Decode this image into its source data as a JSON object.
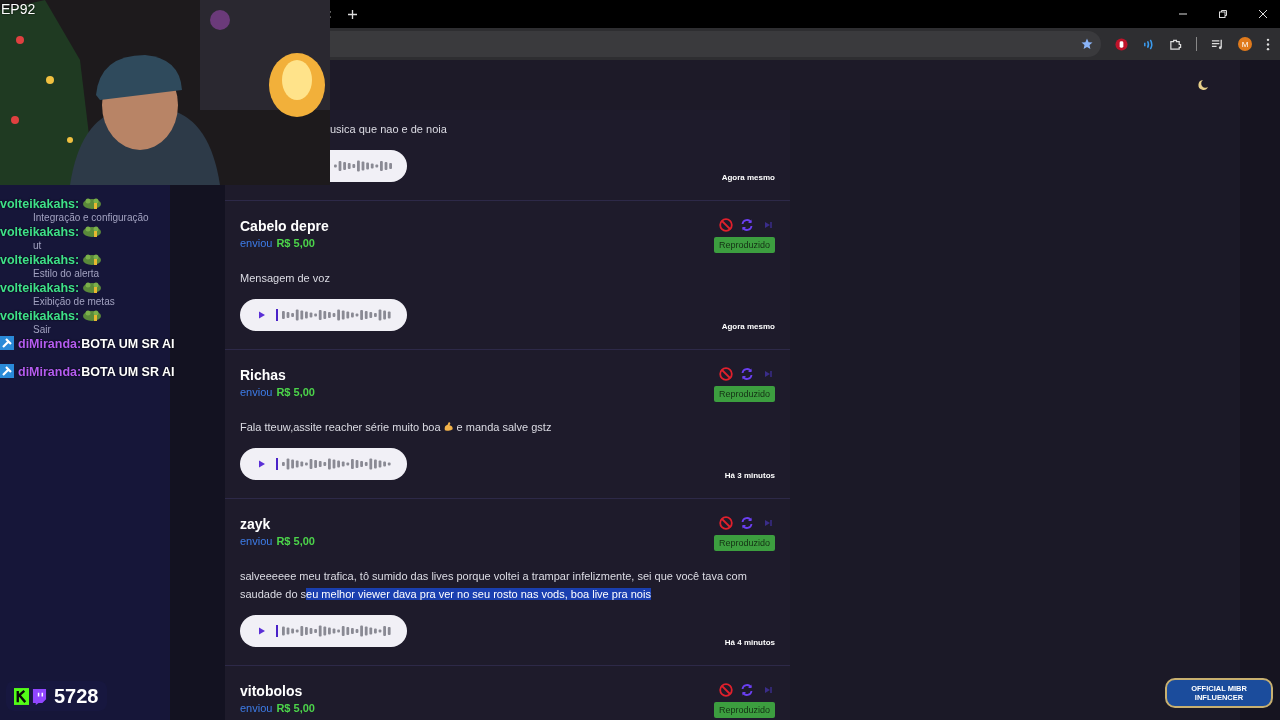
{
  "overlay": {
    "episode": "EP92",
    "chat": [
      {
        "user": "volteikakahs:",
        "color": "#3fe08a",
        "badge": false,
        "emote": true
      },
      {
        "user": "volteikakahs:",
        "color": "#3fe08a",
        "badge": false,
        "emote": true
      },
      {
        "user": "volteikakahs:",
        "color": "#3fe08a",
        "badge": false,
        "emote": true
      },
      {
        "user": "volteikakahs:",
        "color": "#3fe08a",
        "badge": false,
        "emote": true
      },
      {
        "user": "volteikakahs:",
        "color": "#3fe08a",
        "badge": false,
        "emote": true
      },
      {
        "user": "diMiranda:",
        "color": "#b45cf0",
        "badge": true,
        "emote": false,
        "text": "BOTA UM SR AI"
      },
      {
        "user": "diMiranda:",
        "color": "#b45cf0",
        "badge": true,
        "emote": false,
        "text": "BOTA UM SR AI"
      }
    ],
    "viewer_count": "5728",
    "badge": "OFFICIAL MIBR INFLUENCER"
  },
  "browser": {
    "profile_initial": "M"
  },
  "sidebar": {
    "items": [
      {
        "label": "Integração e configuração"
      },
      {
        "label": "ut"
      },
      {
        "label": "Estilo do alerta"
      },
      {
        "label": "Exibição de metas"
      },
      {
        "label": "Sair"
      }
    ]
  },
  "donations": [
    {
      "parts": [
        {
          "kind": "text",
          "text": "usica que nao e de noia"
        }
      ],
      "time": "Agora mesmo"
    },
    {
      "name": "Cabelo depre",
      "sent": "enviou",
      "amount": "R$ 5,00",
      "status": "Reproduzido",
      "parts": [
        {
          "kind": "text",
          "text": "Mensagem de voz"
        }
      ],
      "time": "Agora mesmo"
    },
    {
      "name": "Richas",
      "sent": "enviou",
      "amount": "R$ 5,00",
      "status": "Reproduzido",
      "parts": [
        {
          "kind": "text",
          "text": "Fala tteuw,assite reacher série muito boa"
        },
        {
          "kind": "emoji"
        },
        {
          "kind": "text",
          "text": " e manda salve gstz"
        }
      ],
      "time": "Há 3 minutos"
    },
    {
      "name": "zayk",
      "sent": "enviou",
      "amount": "R$ 5,00",
      "status": "Reproduzido",
      "parts": [
        {
          "kind": "text",
          "text": "salveeeeee meu trafica, tô sumido das lives porque voltei a trampar infelizmente, sei que você tava com saudade do s"
        },
        {
          "kind": "selection",
          "text": "eu melhor viewer dava pra ver no seu rosto nas vods, boa live pra nois"
        }
      ],
      "time": "Há 4 minutos"
    },
    {
      "name": "vitobolos",
      "sent": "enviou",
      "amount": "R$ 5,00",
      "status": "Reproduzido"
    }
  ]
}
